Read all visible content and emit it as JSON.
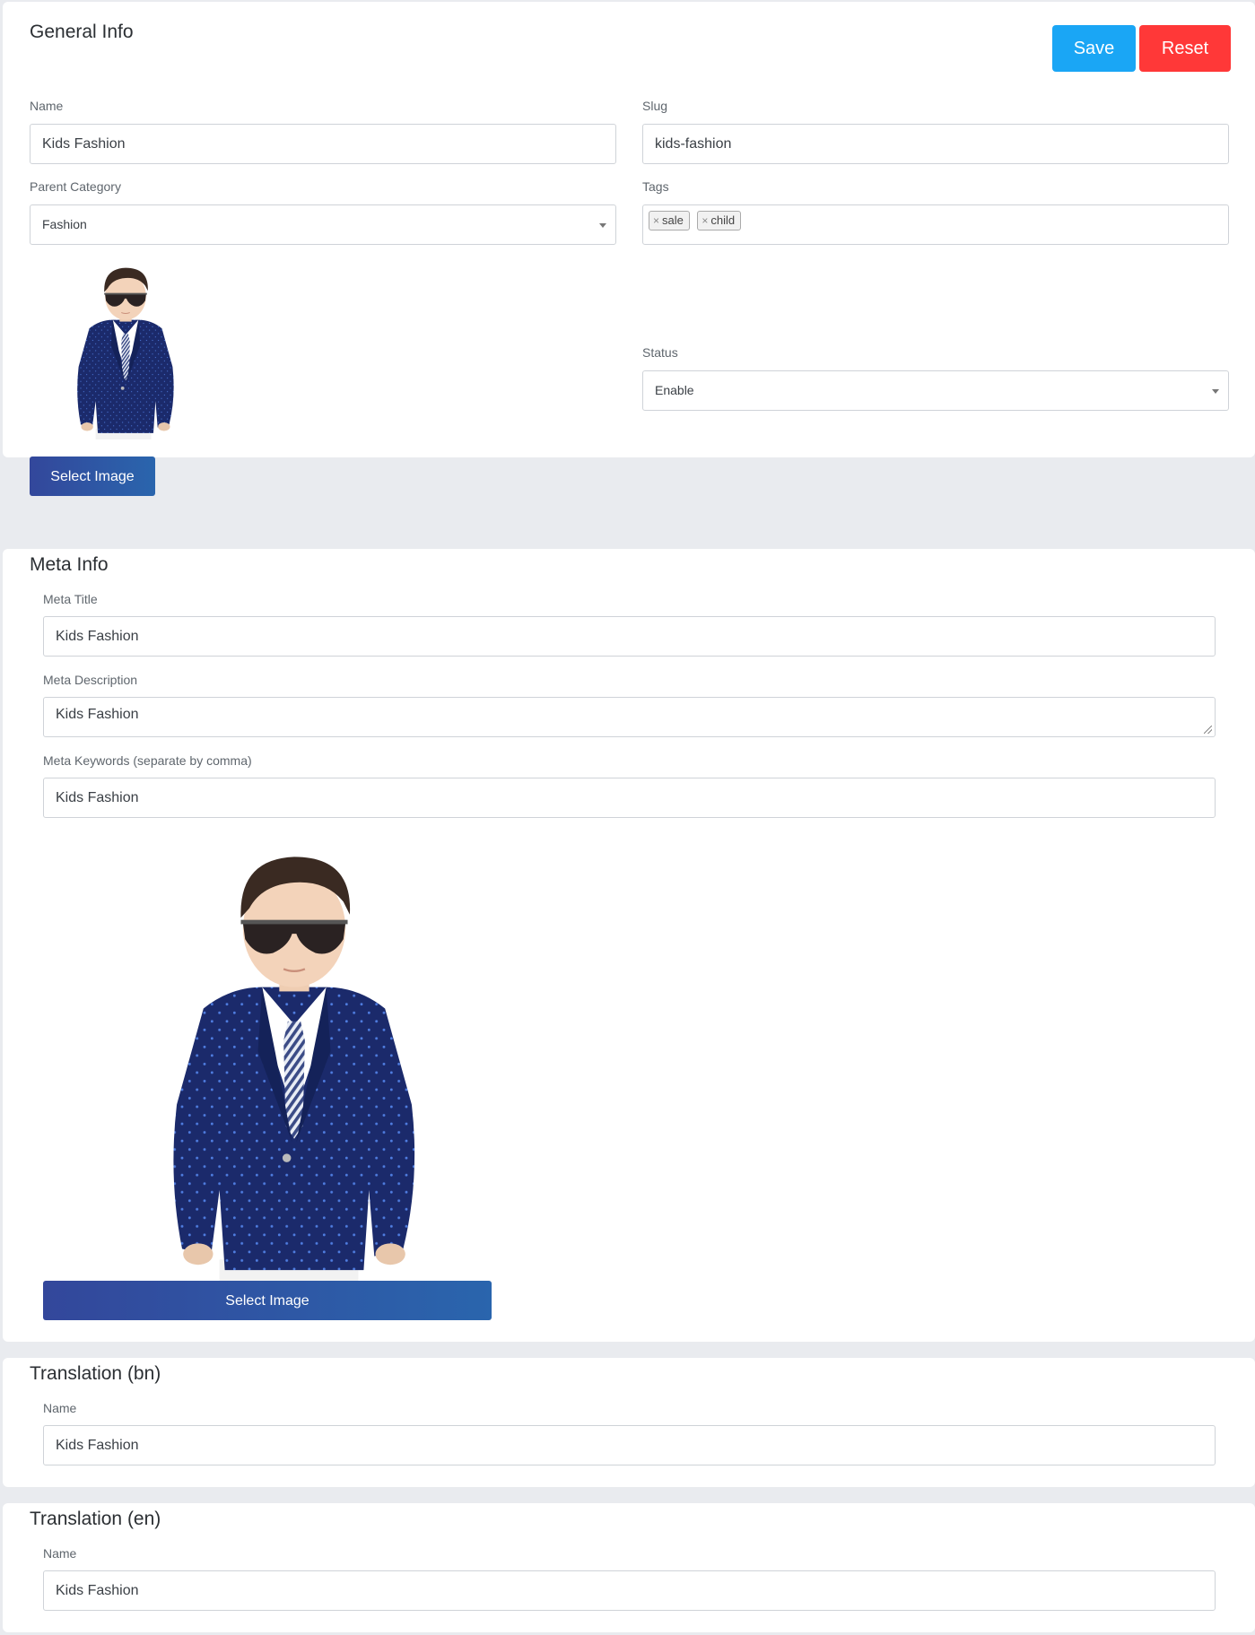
{
  "general": {
    "title": "General Info",
    "save_label": "Save",
    "reset_label": "Reset",
    "name_label": "Name",
    "name_value": "Kids Fashion",
    "slug_label": "Slug",
    "slug_value": "kids-fashion",
    "parent_label": "Parent Category",
    "parent_value": "Fashion",
    "tags_label": "Tags",
    "tags": [
      "sale",
      "child"
    ],
    "status_label": "Status",
    "status_value": "Enable",
    "select_image_label": "Select Image"
  },
  "meta": {
    "title": "Meta Info",
    "meta_title_label": "Meta Title",
    "meta_title_value": "Kids Fashion",
    "meta_description_label": "Meta Description",
    "meta_description_value": "Kids Fashion",
    "meta_keywords_label": "Meta Keywords (separate by comma)",
    "meta_keywords_value": "Kids Fashion",
    "select_image_label": "Select Image"
  },
  "translation_bn": {
    "title": "Translation (bn)",
    "name_label": "Name",
    "name_value": "Kids Fashion"
  },
  "translation_en": {
    "title": "Translation (en)",
    "name_label": "Name",
    "name_value": "Kids Fashion"
  },
  "icons": {
    "dropdown": "chevron-down-icon",
    "tag_remove": "close-icon"
  },
  "colors": {
    "save": "#1aa6f5",
    "reset": "#ff3838",
    "select_image_start": "#33479b",
    "select_image_end": "#2a65ad"
  }
}
